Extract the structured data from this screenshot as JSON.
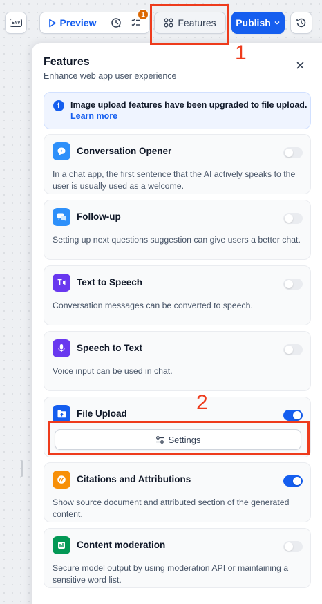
{
  "toolbar": {
    "env_label": "ENV",
    "preview_label": "Preview",
    "badge_count": "1",
    "features_label": "Features",
    "publish_label": "Publish"
  },
  "annotations": {
    "n1": "1",
    "n2": "2"
  },
  "panel": {
    "title": "Features",
    "subtitle": "Enhance web app user experience",
    "info_text": "Image upload features have been upgraded to file upload.",
    "info_link": "Learn more",
    "features": [
      {
        "title": "Conversation Opener",
        "desc": "In a chat app, the first sentence that the AI actively speaks to the user is usually used as a welcome.",
        "enabled": false,
        "icon": "chat-bubble-icon",
        "color": "#2e90fa"
      },
      {
        "title": "Follow-up",
        "desc": "Setting up next questions suggestion can give users a better chat.",
        "enabled": false,
        "icon": "messages-icon",
        "color": "#2e90fa"
      },
      {
        "title": "Text to Speech",
        "desc": "Conversation messages can be converted to speech.",
        "enabled": false,
        "icon": "text-to-speech-icon",
        "color": "#6938ef"
      },
      {
        "title": "Speech to Text",
        "desc": "Voice input can be used in chat.",
        "enabled": false,
        "icon": "microphone-icon",
        "color": "#6938ef"
      },
      {
        "title": "File Upload",
        "desc": "",
        "enabled": true,
        "icon": "folder-upload-icon",
        "color": "#155eef",
        "settings_label": "Settings"
      },
      {
        "title": "Citations and Attributions",
        "desc": "Show source document and attributed section of the generated content.",
        "enabled": true,
        "icon": "quote-icon",
        "color": "#f79009"
      },
      {
        "title": "Content moderation",
        "desc": "Secure model output by using moderation API or maintaining a sensitive word list.",
        "enabled": false,
        "icon": "moderation-icon",
        "color": "#039855"
      }
    ]
  },
  "colors": {
    "accent": "#155eef",
    "annotation": "#ee3b1c"
  }
}
